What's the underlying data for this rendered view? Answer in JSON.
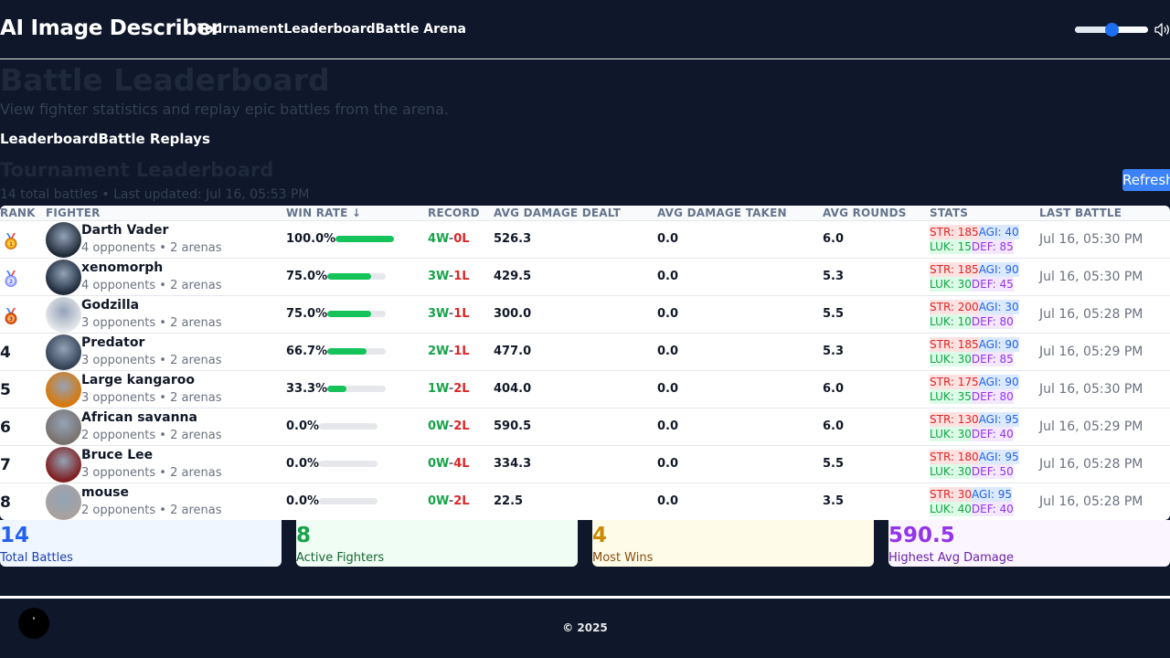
{
  "header": {
    "brand": "AI Image Describer",
    "nav": [
      "Tournament",
      "Leaderboard",
      "Battle Arena"
    ],
    "volume": 0.5
  },
  "page": {
    "title": "Battle Leaderboard",
    "subtitle": "View fighter statistics and replay epic battles from the arena.",
    "tabs": [
      "Leaderboard",
      "Battle Replays"
    ]
  },
  "leaderboard": {
    "title": "Tournament Leaderboard",
    "meta": "14 total battles • Last updated: Jul 16, 05:53 PM",
    "refresh_label": "Refresh",
    "columns": [
      "RANK",
      "FIGHTER",
      "WIN RATE ↓",
      "RECORD",
      "AVG DAMAGE DEALT",
      "AVG DAMAGE TAKEN",
      "AVG ROUNDS",
      "STATS",
      "LAST BATTLE"
    ],
    "rows": [
      {
        "rank": "1",
        "medal": "gold-medal-icon",
        "name": "Darth Vader",
        "meta": "4 opponents • 2 arenas",
        "win_rate": "100.0%",
        "win_fraction": 1.0,
        "wins": "4W",
        "losses": "0L",
        "dealt": "526.3",
        "taken": "0.0",
        "rounds": "6.0",
        "str": "STR: 185",
        "agi": "AGI: 40",
        "luk": "LUK: 15",
        "def": "DEF: 85",
        "last": "Jul 16, 05:30 PM",
        "avatar": "#1f2937"
      },
      {
        "rank": "2",
        "medal": "silver-medal-icon",
        "name": "xenomorph",
        "meta": "4 opponents • 2 arenas",
        "win_rate": "75.0%",
        "win_fraction": 0.75,
        "wins": "3W",
        "losses": "1L",
        "dealt": "429.5",
        "taken": "0.0",
        "rounds": "5.3",
        "str": "STR: 185",
        "agi": "AGI: 90",
        "luk": "LUK: 30",
        "def": "DEF: 45",
        "last": "Jul 16, 05:30 PM",
        "avatar": "#1e293b"
      },
      {
        "rank": "3",
        "medal": "bronze-medal-icon",
        "name": "Godzilla",
        "meta": "3 opponents • 2 arenas",
        "win_rate": "75.0%",
        "win_fraction": 0.75,
        "wins": "3W",
        "losses": "1L",
        "dealt": "300.0",
        "taken": "0.0",
        "rounds": "5.5",
        "str": "STR: 200",
        "agi": "AGI: 30",
        "luk": "LUK: 10",
        "def": "DEF: 80",
        "last": "Jul 16, 05:28 PM",
        "avatar": "#e5e7eb"
      },
      {
        "rank": "4",
        "medal": "",
        "name": "Predator",
        "meta": "3 opponents • 2 arenas",
        "win_rate": "66.7%",
        "win_fraction": 0.667,
        "wins": "2W",
        "losses": "1L",
        "dealt": "477.0",
        "taken": "0.0",
        "rounds": "5.3",
        "str": "STR: 185",
        "agi": "AGI: 90",
        "luk": "LUK: 30",
        "def": "DEF: 85",
        "last": "Jul 16, 05:29 PM",
        "avatar": "#334155"
      },
      {
        "rank": "5",
        "medal": "",
        "name": "Large kangaroo",
        "meta": "3 opponents • 2 arenas",
        "win_rate": "33.3%",
        "win_fraction": 0.333,
        "wins": "1W",
        "losses": "2L",
        "dealt": "404.0",
        "taken": "0.0",
        "rounds": "6.0",
        "str": "STR: 175",
        "agi": "AGI: 90",
        "luk": "LUK: 35",
        "def": "DEF: 80",
        "last": "Jul 16, 05:30 PM",
        "avatar": "#d97706"
      },
      {
        "rank": "6",
        "medal": "",
        "name": "African savanna",
        "meta": "2 opponents • 2 arenas",
        "win_rate": "0.0%",
        "win_fraction": 0.0,
        "wins": "0W",
        "losses": "2L",
        "dealt": "590.5",
        "taken": "0.0",
        "rounds": "6.0",
        "str": "STR: 130",
        "agi": "AGI: 95",
        "luk": "LUK: 30",
        "def": "DEF: 40",
        "last": "Jul 16, 05:29 PM",
        "avatar": "#78716c"
      },
      {
        "rank": "7",
        "medal": "",
        "name": "Bruce Lee",
        "meta": "3 opponents • 2 arenas",
        "win_rate": "0.0%",
        "win_fraction": 0.0,
        "wins": "0W",
        "losses": "4L",
        "dealt": "334.3",
        "taken": "0.0",
        "rounds": "5.5",
        "str": "STR: 180",
        "agi": "AGI: 95",
        "luk": "LUK: 30",
        "def": "DEF: 50",
        "last": "Jul 16, 05:28 PM",
        "avatar": "#7f1d1d"
      },
      {
        "rank": "8",
        "medal": "",
        "name": "mouse",
        "meta": "2 opponents • 2 arenas",
        "win_rate": "0.0%",
        "win_fraction": 0.0,
        "wins": "0W",
        "losses": "2L",
        "dealt": "22.5",
        "taken": "0.0",
        "rounds": "3.5",
        "str": "STR: 30",
        "agi": "AGI: 95",
        "luk": "LUK: 40",
        "def": "DEF: 40",
        "last": "Jul 16, 05:28 PM",
        "avatar": "#a8a29e"
      }
    ]
  },
  "summary": [
    {
      "value": "14",
      "label": "Total Battles",
      "bg": "#eff6ff",
      "value_color": "#2563eb",
      "label_color": "#1e40af"
    },
    {
      "value": "8",
      "label": "Active Fighters",
      "bg": "#f0fdf4",
      "value_color": "#16a34a",
      "label_color": "#166534"
    },
    {
      "value": "4",
      "label": "Most Wins",
      "bg": "#fefce8",
      "value_color": "#ca8a04",
      "label_color": "#854d0e"
    },
    {
      "value": "590.5",
      "label": "Highest Avg Damage",
      "bg": "#faf5ff",
      "value_color": "#9333ea",
      "label_color": "#6b21a8"
    }
  ],
  "footer": {
    "copyright": "© 2025"
  }
}
